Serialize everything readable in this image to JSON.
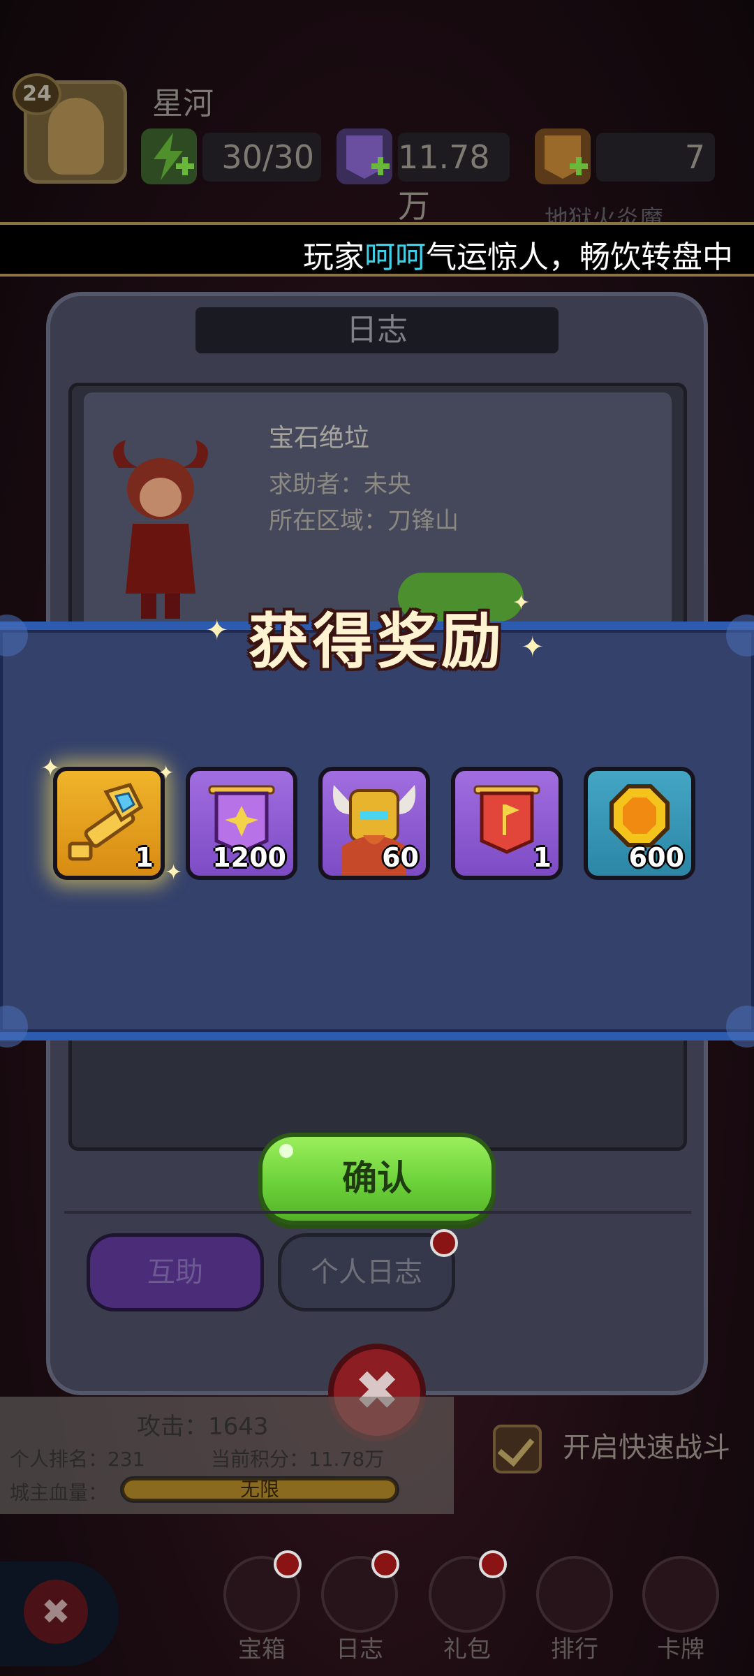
{
  "player": {
    "level": "24",
    "name": "星河",
    "energy": "30/30",
    "points": "11.78万",
    "tickets": "7",
    "obscured_label": "地狱火炎魔"
  },
  "marquee": {
    "prefix": "玩家",
    "highlight": "呵呵",
    "suffix": "气运惊人，畅饮转盘中"
  },
  "log_dialog": {
    "title": "日志",
    "entry": {
      "title": "宝石绝垃",
      "helper": "求助者：未央",
      "region": "所在区域：刀锋山"
    },
    "confirm_label": "确认",
    "tabs": {
      "mutual_help": "互助",
      "personal_log": "个人日志"
    }
  },
  "reward_popup": {
    "title": "获得奖励",
    "items": [
      {
        "name": "golden-key",
        "quantity": "1",
        "color": "#e9a21f"
      },
      {
        "name": "purple-banner",
        "quantity": "1200",
        "color": "#8e5cd4"
      },
      {
        "name": "warrior-hero",
        "quantity": "60",
        "color": "#8e5cd4"
      },
      {
        "name": "red-flag-banner",
        "quantity": "1",
        "color": "#8e5cd4"
      },
      {
        "name": "gold-coin",
        "quantity": "600",
        "color": "#2f93b5"
      }
    ]
  },
  "battle": {
    "attack": "攻击：1643",
    "rank": "个人排名：231",
    "score": "当前积分：11.78万",
    "boss_hp_label": "城主血量：",
    "boss_hp_value": "无限",
    "fast_battle": "开启快速战斗"
  },
  "bottom_nav": [
    "宝箱",
    "日志",
    "礼包",
    "排行",
    "卡牌"
  ]
}
